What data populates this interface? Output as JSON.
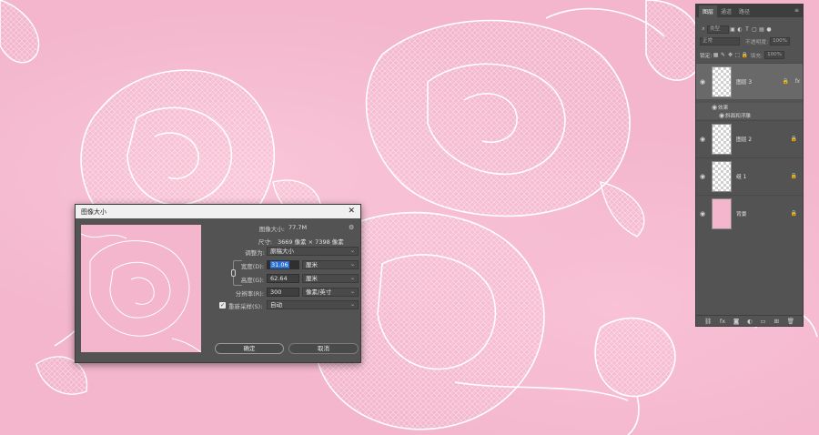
{
  "dialog": {
    "title": "图像大小",
    "image_size_label": "图像大小:",
    "image_size_value": "77.7M",
    "dimensions_label": "尺寸:",
    "dimensions_value": "3669 像素 × 7398 像素",
    "fit_to_label": "调整为:",
    "fit_to_value": "原稿大小",
    "width_label": "宽度(D):",
    "width_value": "31.06",
    "width_unit": "厘米",
    "height_label": "高度(G):",
    "height_value": "62.64",
    "height_unit": "厘米",
    "resolution_label": "分辨率(R):",
    "resolution_value": "300",
    "resolution_unit": "像素/英寸",
    "resample_label": "重新采样(S):",
    "resample_value": "自动",
    "ok_label": "确定",
    "cancel_label": "取消",
    "close_icon": "close-icon"
  },
  "layers_panel": {
    "tabs": [
      "图层",
      "通道",
      "路径"
    ],
    "active_tab_index": 0,
    "filter_placeholder": "类型",
    "blend_mode": "正常",
    "opacity_label": "不透明度:",
    "opacity_value": "100%",
    "lock_label": "锁定:",
    "fill_label": "填充:",
    "fill_value": "100%",
    "layers": [
      {
        "name": "图层 3",
        "selected": true,
        "locked": true,
        "has_fx": true,
        "effects_label": "效果",
        "effects": [
          "斜面和浮雕"
        ]
      },
      {
        "name": "图层 2",
        "selected": false,
        "locked": true,
        "has_fx": false
      },
      {
        "name": "组 1",
        "selected": false,
        "locked": true,
        "has_fx": false
      },
      {
        "name": "背景",
        "selected": false,
        "locked": true,
        "has_fx": false
      }
    ],
    "bottom_icons": [
      "link-icon",
      "fx-icon",
      "mask-icon",
      "adjustment-icon",
      "folder-icon",
      "new-layer-icon",
      "trash-icon"
    ]
  },
  "colors": {
    "canvas_pink": "#f3b6cd",
    "panel_gray": "#535353",
    "accent_blue": "#2a6fd6"
  }
}
